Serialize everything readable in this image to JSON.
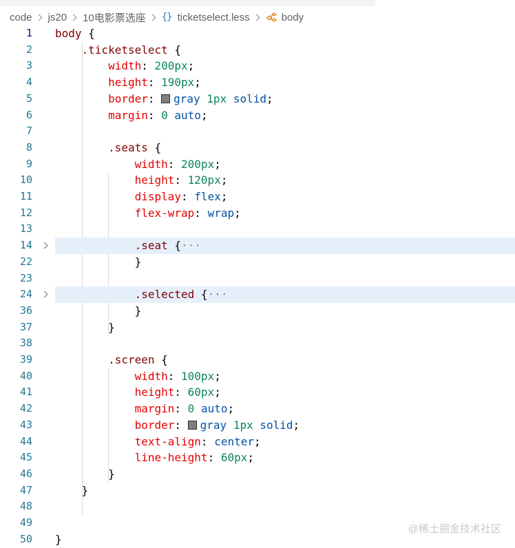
{
  "breadcrumb": {
    "items": [
      "code",
      "js20",
      "10电影票选座",
      "ticketselect.less",
      "body"
    ]
  },
  "editor": {
    "current_line": "1",
    "lines": [
      {
        "num": "1",
        "tokens": [
          {
            "t": "sel",
            "v": "body"
          },
          {
            "t": "punct",
            "v": " {"
          }
        ]
      },
      {
        "num": "2",
        "tokens": [
          {
            "t": "punct",
            "v": "    "
          },
          {
            "t": "sel",
            "v": ".ticketselect"
          },
          {
            "t": "punct",
            "v": " {"
          }
        ]
      },
      {
        "num": "3",
        "tokens": [
          {
            "t": "punct",
            "v": "        "
          },
          {
            "t": "prop",
            "v": "width"
          },
          {
            "t": "punct",
            "v": ": "
          },
          {
            "t": "num",
            "v": "200px"
          },
          {
            "t": "punct",
            "v": ";"
          }
        ]
      },
      {
        "num": "4",
        "tokens": [
          {
            "t": "punct",
            "v": "        "
          },
          {
            "t": "prop",
            "v": "height"
          },
          {
            "t": "punct",
            "v": ": "
          },
          {
            "t": "num",
            "v": "190px"
          },
          {
            "t": "punct",
            "v": ";"
          }
        ]
      },
      {
        "num": "5",
        "tokens": [
          {
            "t": "punct",
            "v": "        "
          },
          {
            "t": "prop",
            "v": "border"
          },
          {
            "t": "punct",
            "v": ": "
          },
          {
            "t": "swatch",
            "v": ""
          },
          {
            "t": "kw",
            "v": "gray"
          },
          {
            "t": "punct",
            "v": " "
          },
          {
            "t": "num",
            "v": "1px"
          },
          {
            "t": "punct",
            "v": " "
          },
          {
            "t": "kw",
            "v": "solid"
          },
          {
            "t": "punct",
            "v": ";"
          }
        ]
      },
      {
        "num": "6",
        "tokens": [
          {
            "t": "punct",
            "v": "        "
          },
          {
            "t": "prop",
            "v": "margin"
          },
          {
            "t": "punct",
            "v": ": "
          },
          {
            "t": "num",
            "v": "0"
          },
          {
            "t": "punct",
            "v": " "
          },
          {
            "t": "kw",
            "v": "auto"
          },
          {
            "t": "punct",
            "v": ";"
          }
        ]
      },
      {
        "num": "7",
        "tokens": []
      },
      {
        "num": "8",
        "tokens": [
          {
            "t": "punct",
            "v": "        "
          },
          {
            "t": "sel",
            "v": ".seats"
          },
          {
            "t": "punct",
            "v": " {"
          }
        ]
      },
      {
        "num": "9",
        "tokens": [
          {
            "t": "punct",
            "v": "            "
          },
          {
            "t": "prop",
            "v": "width"
          },
          {
            "t": "punct",
            "v": ": "
          },
          {
            "t": "num",
            "v": "200px"
          },
          {
            "t": "punct",
            "v": ";"
          }
        ]
      },
      {
        "num": "10",
        "tokens": [
          {
            "t": "punct",
            "v": "            "
          },
          {
            "t": "prop",
            "v": "height"
          },
          {
            "t": "punct",
            "v": ": "
          },
          {
            "t": "num",
            "v": "120px"
          },
          {
            "t": "punct",
            "v": ";"
          }
        ]
      },
      {
        "num": "11",
        "tokens": [
          {
            "t": "punct",
            "v": "            "
          },
          {
            "t": "prop",
            "v": "display"
          },
          {
            "t": "punct",
            "v": ": "
          },
          {
            "t": "kw",
            "v": "flex"
          },
          {
            "t": "punct",
            "v": ";"
          }
        ]
      },
      {
        "num": "12",
        "tokens": [
          {
            "t": "punct",
            "v": "            "
          },
          {
            "t": "prop",
            "v": "flex-wrap"
          },
          {
            "t": "punct",
            "v": ": "
          },
          {
            "t": "kw",
            "v": "wrap"
          },
          {
            "t": "punct",
            "v": ";"
          }
        ]
      },
      {
        "num": "13",
        "tokens": []
      },
      {
        "num": "14",
        "fold": true,
        "highlight": true,
        "tokens": [
          {
            "t": "punct",
            "v": "            "
          },
          {
            "t": "sel",
            "v": ".seat"
          },
          {
            "t": "punct",
            "v": " {"
          },
          {
            "t": "ellipsis",
            "v": "···"
          }
        ]
      },
      {
        "num": "22",
        "tokens": [
          {
            "t": "punct",
            "v": "            }"
          }
        ]
      },
      {
        "num": "23",
        "tokens": []
      },
      {
        "num": "24",
        "fold": true,
        "highlight": true,
        "tokens": [
          {
            "t": "punct",
            "v": "            "
          },
          {
            "t": "sel",
            "v": ".selected"
          },
          {
            "t": "punct",
            "v": " {"
          },
          {
            "t": "ellipsis",
            "v": "···"
          }
        ]
      },
      {
        "num": "36",
        "tokens": [
          {
            "t": "punct",
            "v": "            }"
          }
        ]
      },
      {
        "num": "37",
        "tokens": [
          {
            "t": "punct",
            "v": "        }"
          }
        ]
      },
      {
        "num": "38",
        "tokens": []
      },
      {
        "num": "39",
        "tokens": [
          {
            "t": "punct",
            "v": "        "
          },
          {
            "t": "sel",
            "v": ".screen"
          },
          {
            "t": "punct",
            "v": " {"
          }
        ]
      },
      {
        "num": "40",
        "tokens": [
          {
            "t": "punct",
            "v": "            "
          },
          {
            "t": "prop",
            "v": "width"
          },
          {
            "t": "punct",
            "v": ": "
          },
          {
            "t": "num",
            "v": "100px"
          },
          {
            "t": "punct",
            "v": ";"
          }
        ]
      },
      {
        "num": "41",
        "tokens": [
          {
            "t": "punct",
            "v": "            "
          },
          {
            "t": "prop",
            "v": "height"
          },
          {
            "t": "punct",
            "v": ": "
          },
          {
            "t": "num",
            "v": "60px"
          },
          {
            "t": "punct",
            "v": ";"
          }
        ]
      },
      {
        "num": "42",
        "tokens": [
          {
            "t": "punct",
            "v": "            "
          },
          {
            "t": "prop",
            "v": "margin"
          },
          {
            "t": "punct",
            "v": ": "
          },
          {
            "t": "num",
            "v": "0"
          },
          {
            "t": "punct",
            "v": " "
          },
          {
            "t": "kw",
            "v": "auto"
          },
          {
            "t": "punct",
            "v": ";"
          }
        ]
      },
      {
        "num": "43",
        "tokens": [
          {
            "t": "punct",
            "v": "            "
          },
          {
            "t": "prop",
            "v": "border"
          },
          {
            "t": "punct",
            "v": ": "
          },
          {
            "t": "swatch",
            "v": ""
          },
          {
            "t": "kw",
            "v": "gray"
          },
          {
            "t": "punct",
            "v": " "
          },
          {
            "t": "num",
            "v": "1px"
          },
          {
            "t": "punct",
            "v": " "
          },
          {
            "t": "kw",
            "v": "solid"
          },
          {
            "t": "punct",
            "v": ";"
          }
        ]
      },
      {
        "num": "44",
        "tokens": [
          {
            "t": "punct",
            "v": "            "
          },
          {
            "t": "prop",
            "v": "text-align"
          },
          {
            "t": "punct",
            "v": ": "
          },
          {
            "t": "kw",
            "v": "center"
          },
          {
            "t": "punct",
            "v": ";"
          }
        ]
      },
      {
        "num": "45",
        "tokens": [
          {
            "t": "punct",
            "v": "            "
          },
          {
            "t": "prop",
            "v": "line-height"
          },
          {
            "t": "punct",
            "v": ": "
          },
          {
            "t": "num",
            "v": "60px"
          },
          {
            "t": "punct",
            "v": ";"
          }
        ]
      },
      {
        "num": "46",
        "tokens": [
          {
            "t": "punct",
            "v": "        }"
          }
        ]
      },
      {
        "num": "47",
        "tokens": [
          {
            "t": "punct",
            "v": "    }"
          }
        ]
      },
      {
        "num": "48",
        "tokens": []
      },
      {
        "num": "49",
        "tokens": []
      },
      {
        "num": "50",
        "tokens": [
          {
            "t": "punct",
            "v": "}"
          }
        ]
      }
    ]
  },
  "watermark": "@稀土掘金技术社区",
  "colors": {
    "selector": "#800000",
    "property": "#e50000",
    "number": "#098658",
    "keyword": "#0451a5",
    "line_number": "#237893",
    "fold_highlight": "#e5f0fb"
  }
}
